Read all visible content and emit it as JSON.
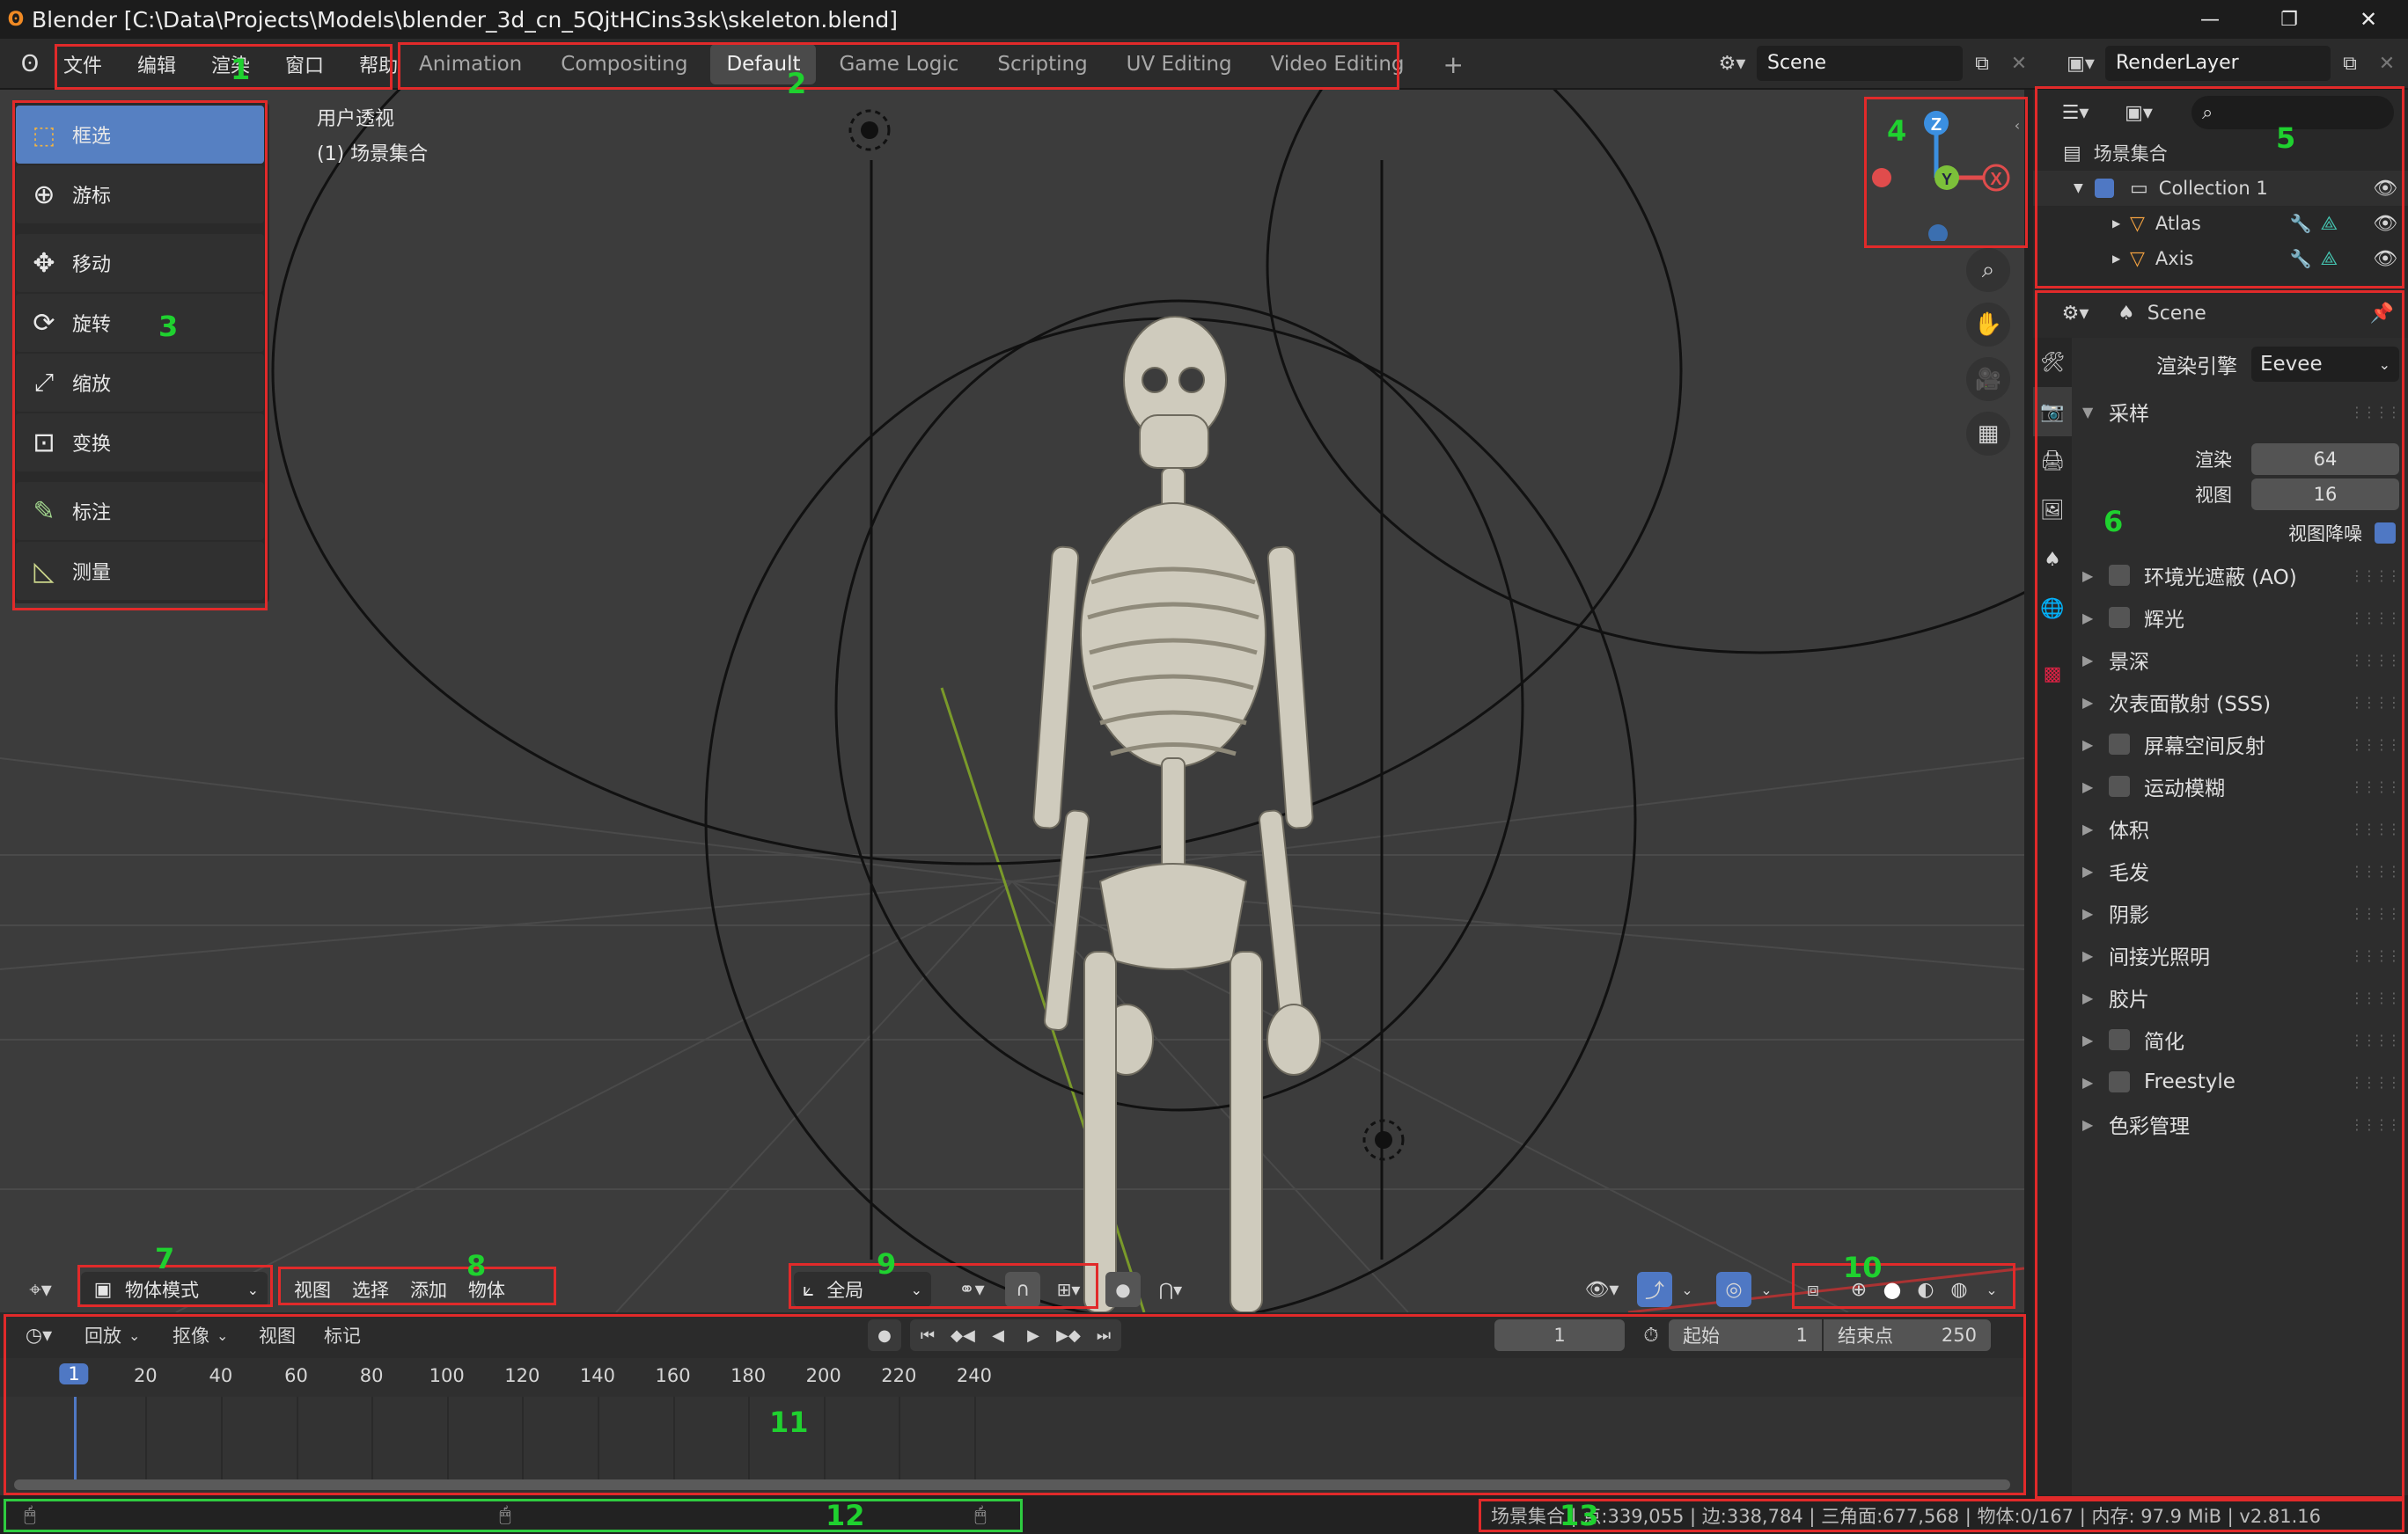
{
  "window": {
    "title": "Blender [C:\\Data\\Projects\\Models\\blender_3d_cn_5QjtHCins3sk\\skeleton.blend]",
    "controls": [
      "—",
      "❐",
      "✕"
    ]
  },
  "menu": {
    "items": [
      "文件",
      "编辑",
      "渲染",
      "窗口",
      "帮助"
    ]
  },
  "workspaces": {
    "tabs": [
      "Animation",
      "Compositing",
      "Default",
      "Game Logic",
      "Scripting",
      "UV Editing",
      "Video Editing"
    ],
    "active": "Default",
    "add": "+"
  },
  "scene_selector": {
    "value": "Scene"
  },
  "layer_selector": {
    "value": "RenderLayer"
  },
  "viewport": {
    "view_name": "用户透视",
    "collection": "(1) 场景集合"
  },
  "gizmo": {
    "z": "Z",
    "x": "X",
    "y": "Y"
  },
  "toolbar": {
    "items": [
      "框选",
      "游标",
      "移动",
      "旋转",
      "缩放",
      "变换",
      "标注",
      "测量"
    ],
    "active": 0
  },
  "viewport_header": {
    "mode": "物体模式",
    "menus": [
      "视图",
      "选择",
      "添加",
      "物体"
    ],
    "transform_orientation": "全局"
  },
  "outliner": {
    "root": "场景集合",
    "collection": "Collection 1",
    "objects": [
      "Atlas",
      "Axis"
    ]
  },
  "properties": {
    "context": "Scene",
    "render_engine_label": "渲染引擎",
    "render_engine": "Eevee",
    "sampling": {
      "title": "采样",
      "render_label": "渲染",
      "render_value": "64",
      "viewport_label": "视图",
      "viewport_value": "16",
      "denoise_label": "视图降噪"
    },
    "panels": [
      {
        "label": "环境光遮蔽 (AO)",
        "check": true
      },
      {
        "label": "辉光",
        "check": true
      },
      {
        "label": "景深",
        "check": false
      },
      {
        "label": "次表面散射 (SSS)",
        "check": false
      },
      {
        "label": "屏幕空间反射",
        "check": true
      },
      {
        "label": "运动模糊",
        "check": true
      },
      {
        "label": "体积",
        "check": false
      },
      {
        "label": "毛发",
        "check": false
      },
      {
        "label": "阴影",
        "check": false
      },
      {
        "label": "间接光照明",
        "check": false
      },
      {
        "label": "胶片",
        "check": false
      },
      {
        "label": "简化",
        "check": true
      },
      {
        "label": "Freestyle",
        "check": true
      },
      {
        "label": "色彩管理",
        "check": false
      }
    ]
  },
  "timeline": {
    "menus": [
      "回放",
      "抠像",
      "视图",
      "标记"
    ],
    "current_frame": "1",
    "start_label": "起始",
    "start_value": "1",
    "end_label": "结束点",
    "end_value": "250",
    "ruler": [
      "1",
      "20",
      "40",
      "60",
      "80",
      "100",
      "120",
      "140",
      "160",
      "180",
      "200",
      "220",
      "240"
    ]
  },
  "statusbar": {
    "text": "场景集合 | 点:339,055 | 边:338,784 | 三角面:677,568 | 物体:0/167 | 内存: 97.9 MiB | v2.81.16"
  },
  "annotations": [
    "1",
    "2",
    "3",
    "4",
    "5",
    "6",
    "7",
    "8",
    "9",
    "10",
    "11",
    "12",
    "13"
  ],
  "colors": {
    "accent": "#5680c2",
    "annotation_box": "#e12a2a",
    "annotation_text": "#1fd12f",
    "viewport_bg": "#3c3c3c"
  }
}
